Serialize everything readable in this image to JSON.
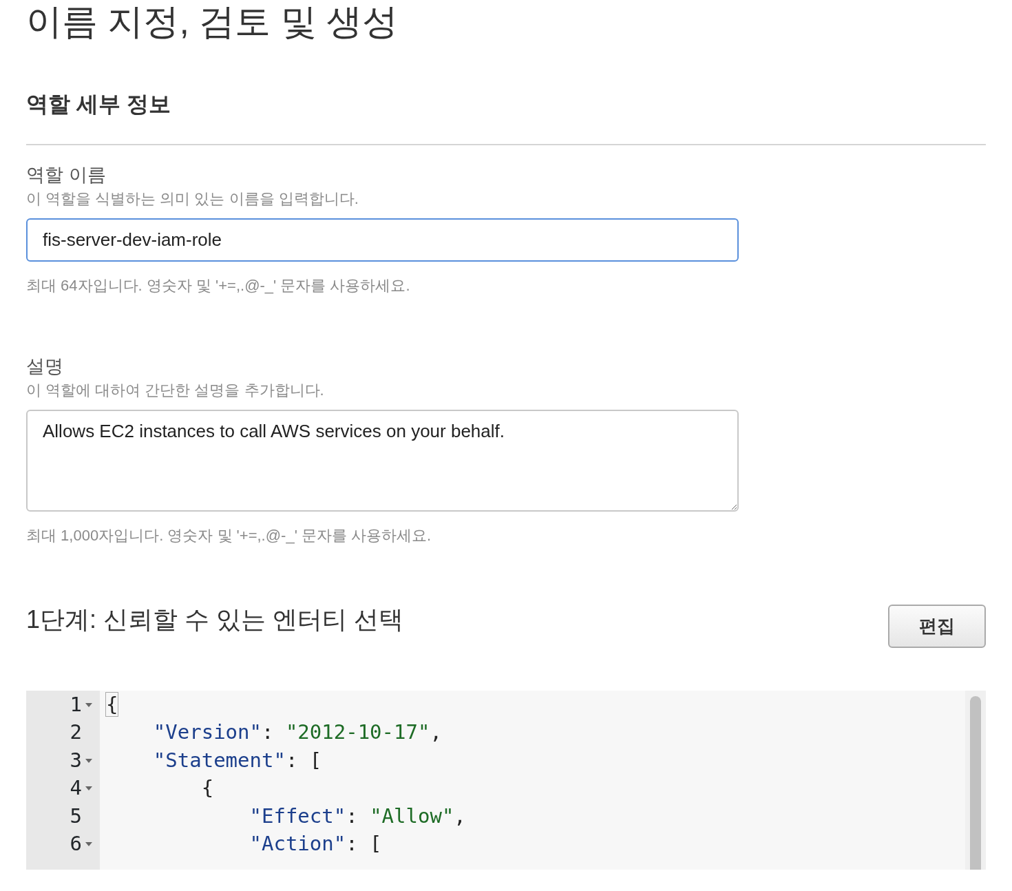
{
  "page_title": "이름 지정, 검토 및 생성",
  "role_details": {
    "heading": "역할 세부 정보",
    "fields": [
      {
        "kind": "input",
        "label": "역할 이름",
        "hint": "이 역할을 식별하는 의미 있는 이름을 입력합니다.",
        "value": "fis-server-dev-iam-role",
        "focused": true,
        "constraint": "최대 64자입니다. 영숫자 및 '+=,.@-_' 문자를 사용하세요."
      },
      {
        "kind": "textarea",
        "label": "설명",
        "hint": "이 역할에 대하여 간단한 설명을 추가합니다.",
        "value": "Allows EC2 instances to call AWS services on your behalf.",
        "focused": false,
        "constraint": "최대 1,000자입니다. 영숫자 및 '+=,.@-_' 문자를 사용하세요."
      }
    ]
  },
  "step1": {
    "heading": "1단계: 신뢰할 수 있는 엔터티 선택",
    "edit_button": "편집",
    "editor": {
      "lines": [
        {
          "number": "1",
          "foldable": true,
          "tokens": [
            {
              "kind": "bracket",
              "text": "{"
            }
          ]
        },
        {
          "number": "2",
          "foldable": false,
          "tokens": [
            {
              "kind": "key",
              "text": "    \"Version\""
            },
            {
              "kind": "punct",
              "text": ": "
            },
            {
              "kind": "string",
              "text": "\"2012-10-17\""
            },
            {
              "kind": "punct",
              "text": ","
            }
          ]
        },
        {
          "number": "3",
          "foldable": true,
          "tokens": [
            {
              "kind": "key",
              "text": "    \"Statement\""
            },
            {
              "kind": "punct",
              "text": ": ["
            }
          ]
        },
        {
          "number": "4",
          "foldable": true,
          "tokens": [
            {
              "kind": "punct",
              "text": "        {"
            }
          ]
        },
        {
          "number": "5",
          "foldable": false,
          "tokens": [
            {
              "kind": "key",
              "text": "            \"Effect\""
            },
            {
              "kind": "punct",
              "text": ": "
            },
            {
              "kind": "string",
              "text": "\"Allow\""
            },
            {
              "kind": "punct",
              "text": ","
            }
          ]
        },
        {
          "number": "6",
          "foldable": true,
          "tokens": [
            {
              "kind": "key",
              "text": "            \"Action\""
            },
            {
              "kind": "punct",
              "text": ": ["
            }
          ]
        }
      ]
    }
  }
}
